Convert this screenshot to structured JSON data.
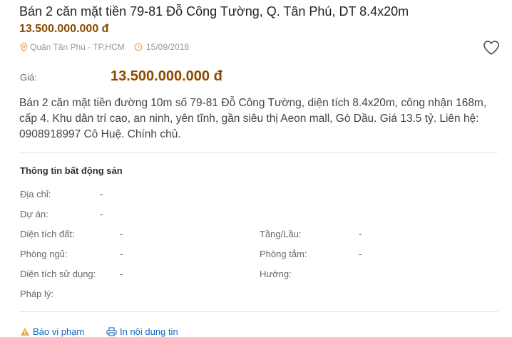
{
  "listing": {
    "title": "Bán 2 căn mặt tiền 79-81 Đỗ Công Tường, Q. Tân Phú, DT 8.4x20m",
    "price": "13.500.000.000 đ",
    "location": "Quận Tân Phú - TP.HCM",
    "date": "15/09/2018",
    "price_label": "Giá:",
    "price_value": "13.500.000.000 đ",
    "description": "Bán 2 căn mặt tiền đường 10m số 79-81 Đỗ Công Tường, diện tích 8.4x20m, công nhận 168m, cấp 4. Khu dân trí cao, an ninh, yên tĩnh, gần siêu thị Aeon mall, Gò Dầu. Giá 13.5 tỷ. Liên hệ: 0908918997 Cô Huệ. Chính chủ."
  },
  "info": {
    "title": "Thông tin bất động sản",
    "address_label": "Địa chỉ:",
    "address_value": "-",
    "project_label": "Dự án:",
    "project_value": "-",
    "land_area_label": "Diện tích đất:",
    "land_area_value": "-",
    "floors_label": "Tầng/Lầu:",
    "floors_value": "-",
    "bedrooms_label": "Phòng ngủ:",
    "bedrooms_value": "-",
    "bathrooms_label": "Phòng tắm:",
    "bathrooms_value": "-",
    "usable_area_label": "Diện tích sử dụng:",
    "usable_area_value": "-",
    "direction_label": "Hướng:",
    "direction_value": "",
    "legal_label": "Pháp lý:",
    "legal_value": ""
  },
  "footer": {
    "report_label": "Báo vi phạm",
    "print_label": "In nội dung tin"
  },
  "colors": {
    "price": "#8a4b00",
    "meta_icon": "#f0a050",
    "link": "#0a66c2"
  },
  "icons": [
    "location-pin-icon",
    "clock-icon",
    "heart-icon",
    "warning-icon",
    "printer-icon"
  ]
}
